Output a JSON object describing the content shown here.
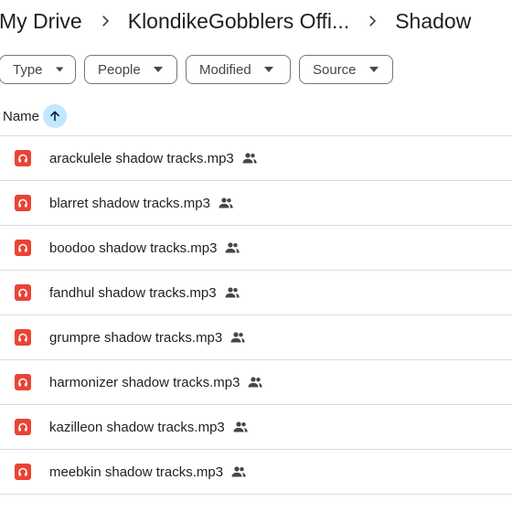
{
  "breadcrumb": {
    "items": [
      "My Drive",
      "KlondikeGobblers Offi..."
    ],
    "current": "Shadow"
  },
  "filters": {
    "type": "Type",
    "people": "People",
    "modified": "Modified",
    "source": "Source"
  },
  "header": {
    "name_label": "Name",
    "sort_direction": "ascending"
  },
  "files": [
    {
      "name": "arackulele shadow tracks.mp3",
      "shared": true,
      "icon": "audio-file-icon"
    },
    {
      "name": "blarret shadow tracks.mp3",
      "shared": true,
      "icon": "audio-file-icon"
    },
    {
      "name": "boodoo shadow tracks.mp3",
      "shared": true,
      "icon": "audio-file-icon"
    },
    {
      "name": "fandhul shadow tracks.mp3",
      "shared": true,
      "icon": "audio-file-icon"
    },
    {
      "name": "grumpre shadow tracks.mp3",
      "shared": true,
      "icon": "audio-file-icon"
    },
    {
      "name": "harmonizer shadow tracks.mp3",
      "shared": true,
      "icon": "audio-file-icon"
    },
    {
      "name": "kazilleon shadow tracks.mp3",
      "shared": true,
      "icon": "audio-file-icon"
    },
    {
      "name": "meebkin shadow tracks.mp3",
      "shared": true,
      "icon": "audio-file-icon"
    }
  ],
  "colors": {
    "audio_icon": "#ea4335",
    "sort_highlight": "#c2e7ff",
    "divider": "#dadce0"
  }
}
